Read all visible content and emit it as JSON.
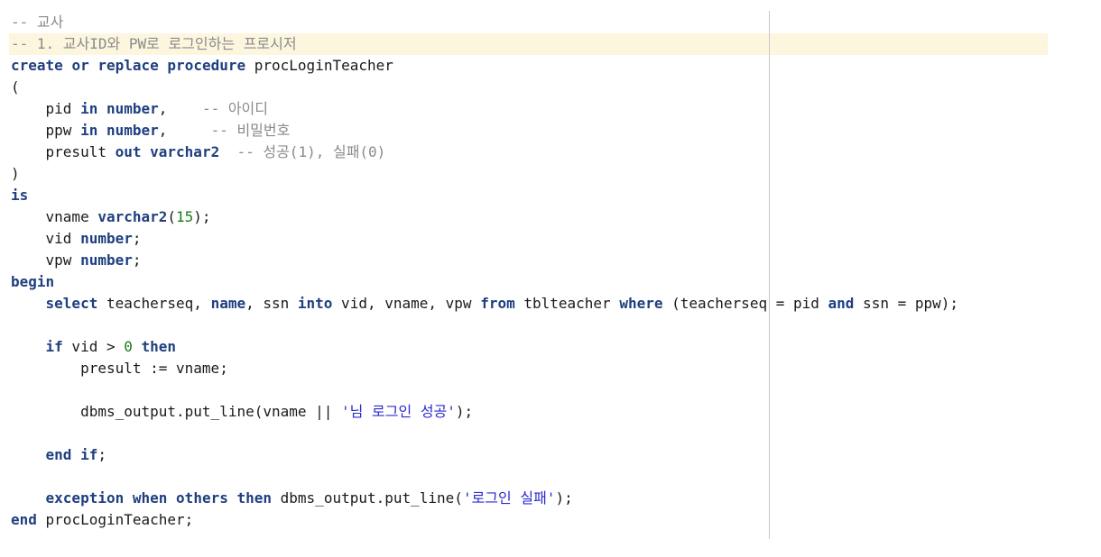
{
  "code_lines": [
    {
      "tokens": [
        {
          "t": "-- 교사",
          "c": "cm"
        }
      ]
    },
    {
      "current": true,
      "tokens": [
        {
          "t": "-- 1. 교사ID와 PW로 로그인하는 프로시저",
          "c": "cm"
        }
      ]
    },
    {
      "tokens": [
        {
          "t": "create",
          "c": "kw"
        },
        {
          "t": " "
        },
        {
          "t": "or",
          "c": "kw"
        },
        {
          "t": " "
        },
        {
          "t": "replace",
          "c": "kw"
        },
        {
          "t": " "
        },
        {
          "t": "procedure",
          "c": "kw"
        },
        {
          "t": " procLoginTeacher"
        }
      ]
    },
    {
      "tokens": [
        {
          "t": "("
        }
      ]
    },
    {
      "tokens": [
        {
          "t": "    pid "
        },
        {
          "t": "in",
          "c": "kw"
        },
        {
          "t": " "
        },
        {
          "t": "number",
          "c": "kw"
        },
        {
          "t": ",    "
        },
        {
          "t": "-- 아이디",
          "c": "cm"
        }
      ]
    },
    {
      "tokens": [
        {
          "t": "    ppw "
        },
        {
          "t": "in",
          "c": "kw"
        },
        {
          "t": " "
        },
        {
          "t": "number",
          "c": "kw"
        },
        {
          "t": ",     "
        },
        {
          "t": "-- 비밀번호",
          "c": "cm"
        }
      ]
    },
    {
      "tokens": [
        {
          "t": "    presult "
        },
        {
          "t": "out",
          "c": "kw"
        },
        {
          "t": " "
        },
        {
          "t": "varchar2",
          "c": "kw"
        },
        {
          "t": "  "
        },
        {
          "t": "-- 성공(1), 실패(0)",
          "c": "cm"
        }
      ]
    },
    {
      "tokens": [
        {
          "t": ")"
        }
      ]
    },
    {
      "tokens": [
        {
          "t": "is",
          "c": "kw"
        }
      ]
    },
    {
      "tokens": [
        {
          "t": "    vname "
        },
        {
          "t": "varchar2",
          "c": "kw"
        },
        {
          "t": "("
        },
        {
          "t": "15",
          "c": "num"
        },
        {
          "t": ");"
        }
      ]
    },
    {
      "tokens": [
        {
          "t": "    vid "
        },
        {
          "t": "number",
          "c": "kw"
        },
        {
          "t": ";"
        }
      ]
    },
    {
      "tokens": [
        {
          "t": "    vpw "
        },
        {
          "t": "number",
          "c": "kw"
        },
        {
          "t": ";"
        }
      ]
    },
    {
      "tokens": [
        {
          "t": "begin",
          "c": "kw"
        }
      ]
    },
    {
      "tokens": [
        {
          "t": "    "
        },
        {
          "t": "select",
          "c": "kw"
        },
        {
          "t": " teacherseq, "
        },
        {
          "t": "name",
          "c": "kw"
        },
        {
          "t": ", ssn "
        },
        {
          "t": "into",
          "c": "kw"
        },
        {
          "t": " vid, vname, vpw "
        },
        {
          "t": "from",
          "c": "kw"
        },
        {
          "t": " tblteacher "
        },
        {
          "t": "where",
          "c": "kw"
        },
        {
          "t": " (teacherseq = pid "
        },
        {
          "t": "and",
          "c": "kw"
        },
        {
          "t": " ssn = ppw);"
        }
      ]
    },
    {
      "tokens": []
    },
    {
      "tokens": [
        {
          "t": "    "
        },
        {
          "t": "if",
          "c": "kw"
        },
        {
          "t": " vid > "
        },
        {
          "t": "0",
          "c": "num"
        },
        {
          "t": " "
        },
        {
          "t": "then",
          "c": "kw"
        }
      ]
    },
    {
      "tokens": [
        {
          "t": "        presult := vname;"
        }
      ]
    },
    {
      "tokens": []
    },
    {
      "tokens": [
        {
          "t": "        dbms_output.put_line(vname || "
        },
        {
          "t": "'님 로그인 성공'",
          "c": "str"
        },
        {
          "t": ");"
        }
      ]
    },
    {
      "tokens": []
    },
    {
      "tokens": [
        {
          "t": "    "
        },
        {
          "t": "end",
          "c": "kw"
        },
        {
          "t": " "
        },
        {
          "t": "if",
          "c": "kw"
        },
        {
          "t": ";"
        }
      ]
    },
    {
      "tokens": []
    },
    {
      "tokens": [
        {
          "t": "    "
        },
        {
          "t": "exception",
          "c": "kw"
        },
        {
          "t": " "
        },
        {
          "t": "when",
          "c": "kw"
        },
        {
          "t": " "
        },
        {
          "t": "others",
          "c": "kw"
        },
        {
          "t": " "
        },
        {
          "t": "then",
          "c": "kw"
        },
        {
          "t": " dbms_output.put_line("
        },
        {
          "t": "'로그인 실패'",
          "c": "str"
        },
        {
          "t": ");"
        }
      ]
    },
    {
      "tokens": [
        {
          "t": "end",
          "c": "kw"
        },
        {
          "t": " procLoginTeacher;"
        }
      ]
    }
  ],
  "colors": {
    "keyword": "#1f3f7f",
    "comment": "#8a8a8a",
    "number": "#1a7a1a",
    "string": "#2a2ad0",
    "current_line": "#fdf6df"
  }
}
